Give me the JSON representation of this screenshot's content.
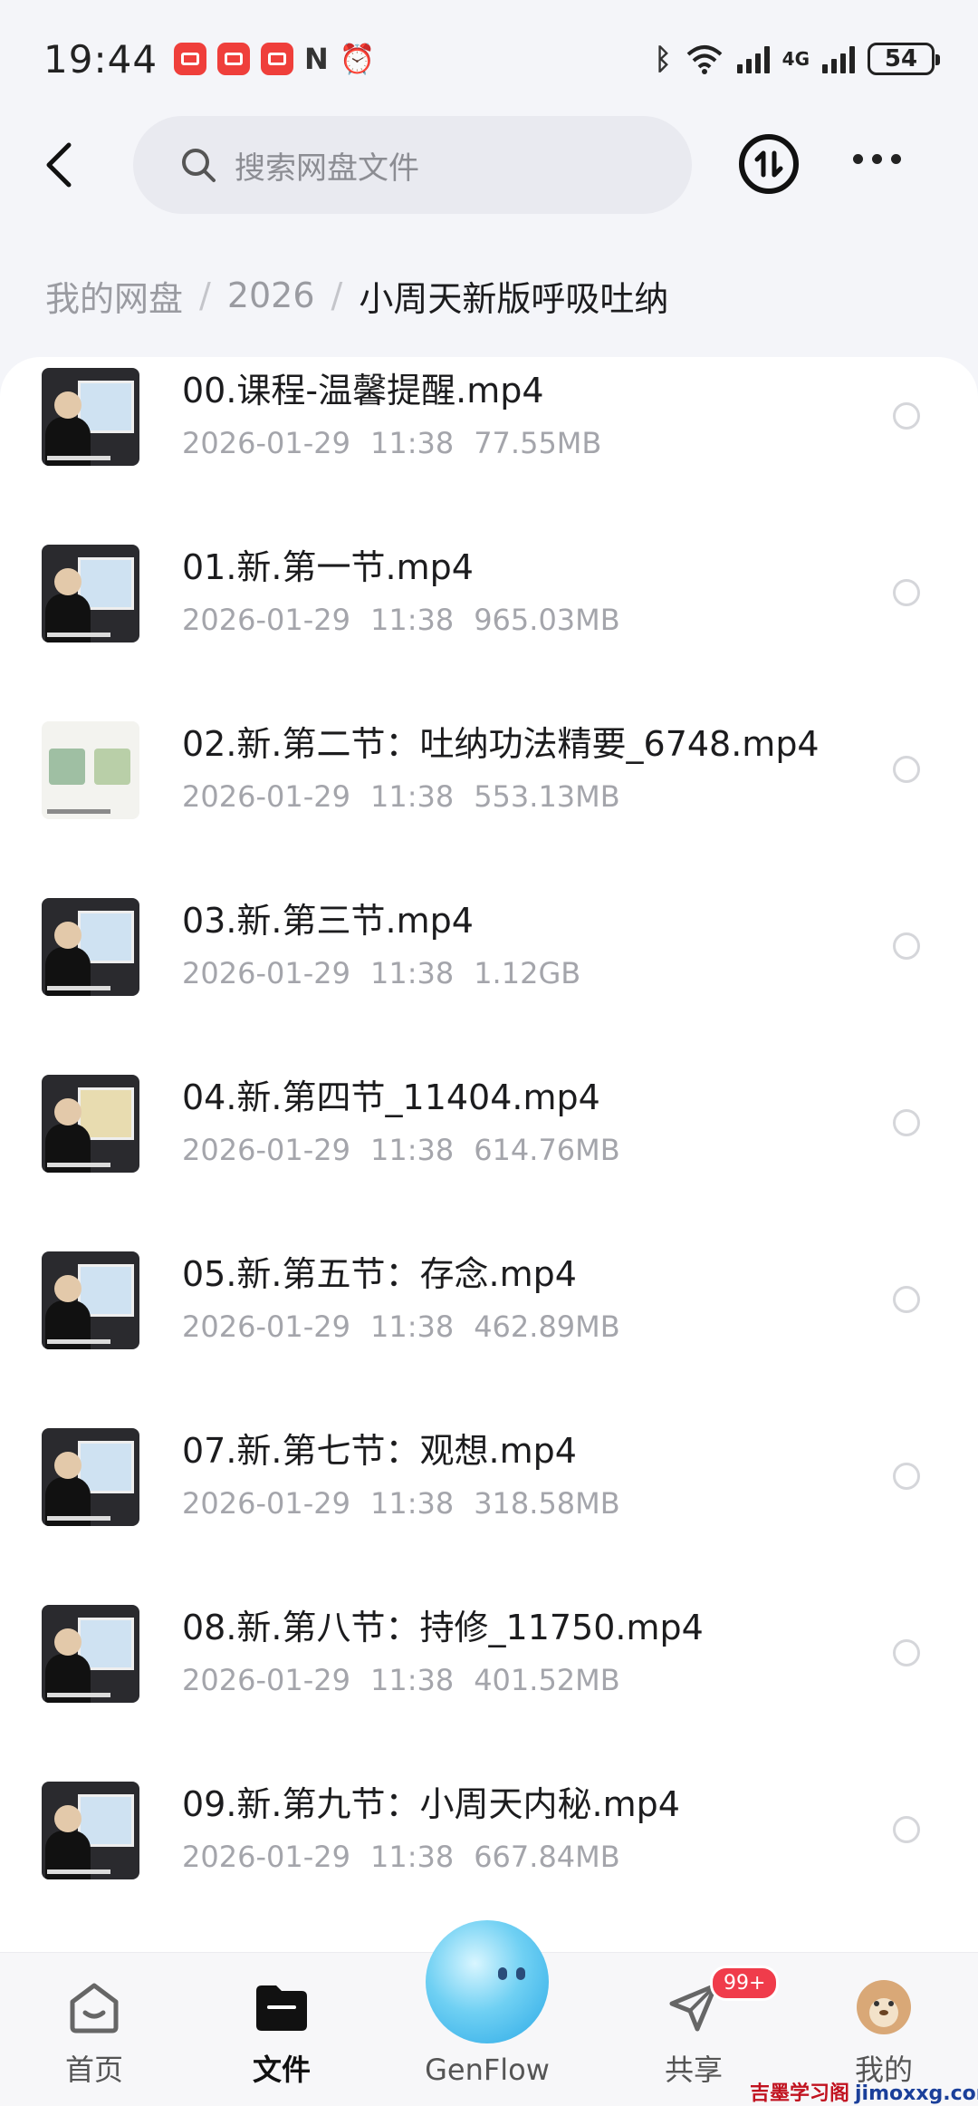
{
  "status_bar": {
    "time": "19:44",
    "network": "4G",
    "battery": "54",
    "icons": [
      "huawei-store-icon",
      "huawei-store-icon",
      "app-icon",
      "nfc-icon",
      "alarm-icon",
      "bluetooth-icon",
      "wifi-icon",
      "signal-icon"
    ]
  },
  "search": {
    "placeholder": "搜索网盘文件"
  },
  "breadcrumb": {
    "items": [
      "我的网盘",
      "2026"
    ],
    "current": "小周天新版呼吸吐纳",
    "separator": "/"
  },
  "files": [
    {
      "name": "00.课程-温馨提醒.mp4",
      "date": "2026-01-29",
      "time": "11:38",
      "size": "77.55MB"
    },
    {
      "name": "01.新.第一节.mp4",
      "date": "2026-01-29",
      "time": "11:38",
      "size": "965.03MB"
    },
    {
      "name": "02.新.第二节：吐纳功法精要_6748.mp4",
      "date": "2026-01-29",
      "time": "11:38",
      "size": "553.13MB"
    },
    {
      "name": "03.新.第三节.mp4",
      "date": "2026-01-29",
      "time": "11:38",
      "size": "1.12GB"
    },
    {
      "name": "04.新.第四节_11404.mp4",
      "date": "2026-01-29",
      "time": "11:38",
      "size": "614.76MB"
    },
    {
      "name": "05.新.第五节：存念.mp4",
      "date": "2026-01-29",
      "time": "11:38",
      "size": "462.89MB"
    },
    {
      "name": "07.新.第七节：观想.mp4",
      "date": "2026-01-29",
      "time": "11:38",
      "size": "318.58MB"
    },
    {
      "name": "08.新.第八节：持修_11750.mp4",
      "date": "2026-01-29",
      "time": "11:38",
      "size": "401.52MB"
    },
    {
      "name": "09.新.第九节：小周天内秘.mp4",
      "date": "2026-01-29",
      "time": "11:38",
      "size": "667.84MB"
    }
  ],
  "bottom_nav": {
    "home": "首页",
    "files": "文件",
    "genflow": "GenFlow",
    "share": "共享",
    "share_badge": "99+",
    "me": "我的"
  },
  "watermark": {
    "text": "吉墨学习阁",
    "domain": "jimoxxg.com"
  },
  "colors": {
    "accent_badge": "#f03c4b",
    "background": "#f4f5f9",
    "card": "#ffffff"
  }
}
